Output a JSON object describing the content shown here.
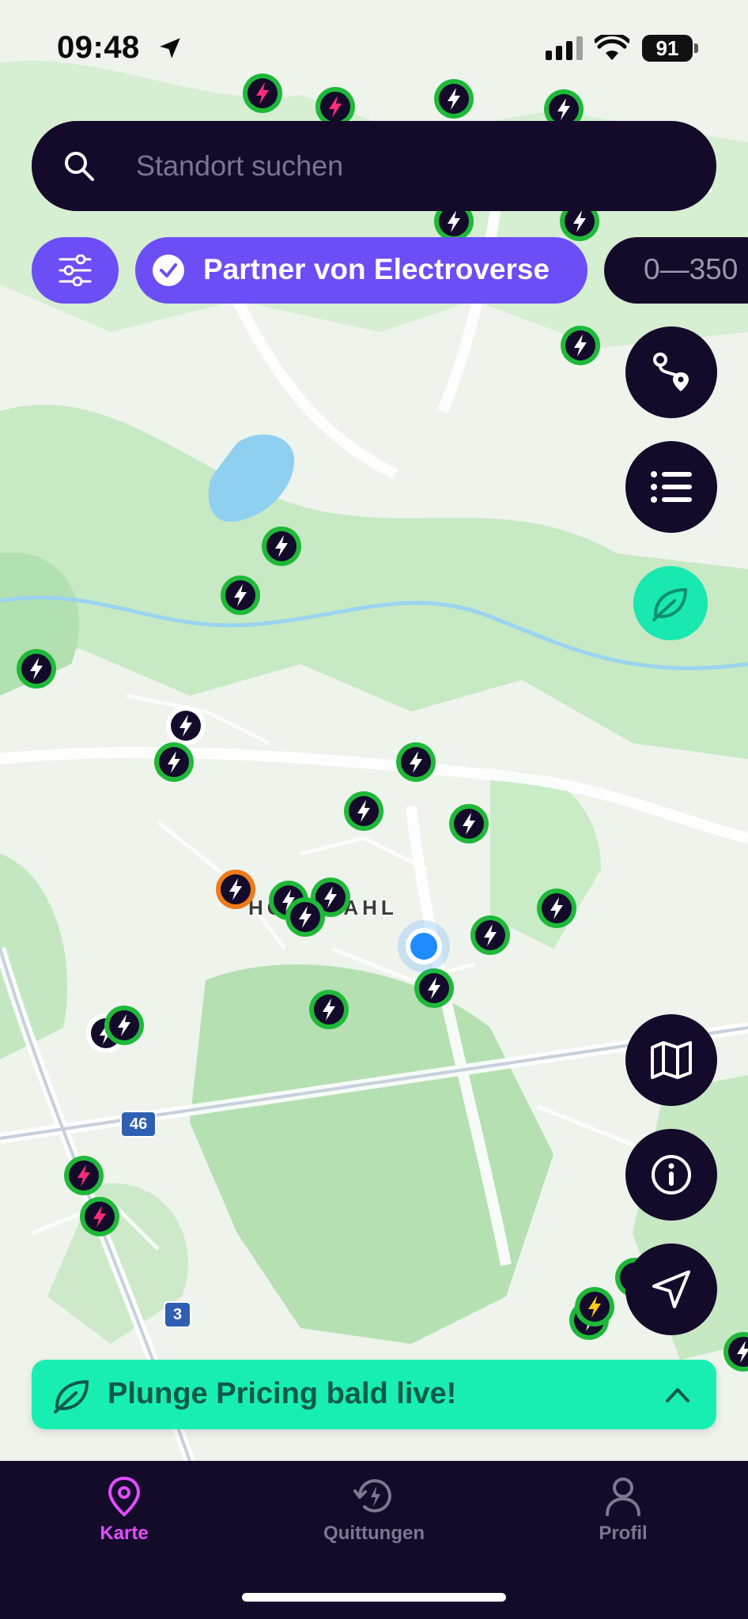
{
  "status_bar": {
    "time": "09:48",
    "battery": "91"
  },
  "search": {
    "placeholder": "Standort suchen"
  },
  "filters": {
    "partner_label": "Partner von Electroverse",
    "power_label": "0—350"
  },
  "map": {
    "place_label": "HOCHDAHL",
    "road_badges": [
      "46",
      "3"
    ]
  },
  "banner": {
    "text": "Plunge Pricing bald live!"
  },
  "tabs": [
    {
      "label": "Karte",
      "active": true
    },
    {
      "label": "Quittungen",
      "active": false
    },
    {
      "label": "Profil",
      "active": false
    }
  ],
  "colors": {
    "brand_dark": "#140a2a",
    "brand_purple": "#6b4ef6",
    "eco_green": "#19eeb2",
    "active_tab": "#e24dff",
    "marker_green": "#1fb83a"
  }
}
